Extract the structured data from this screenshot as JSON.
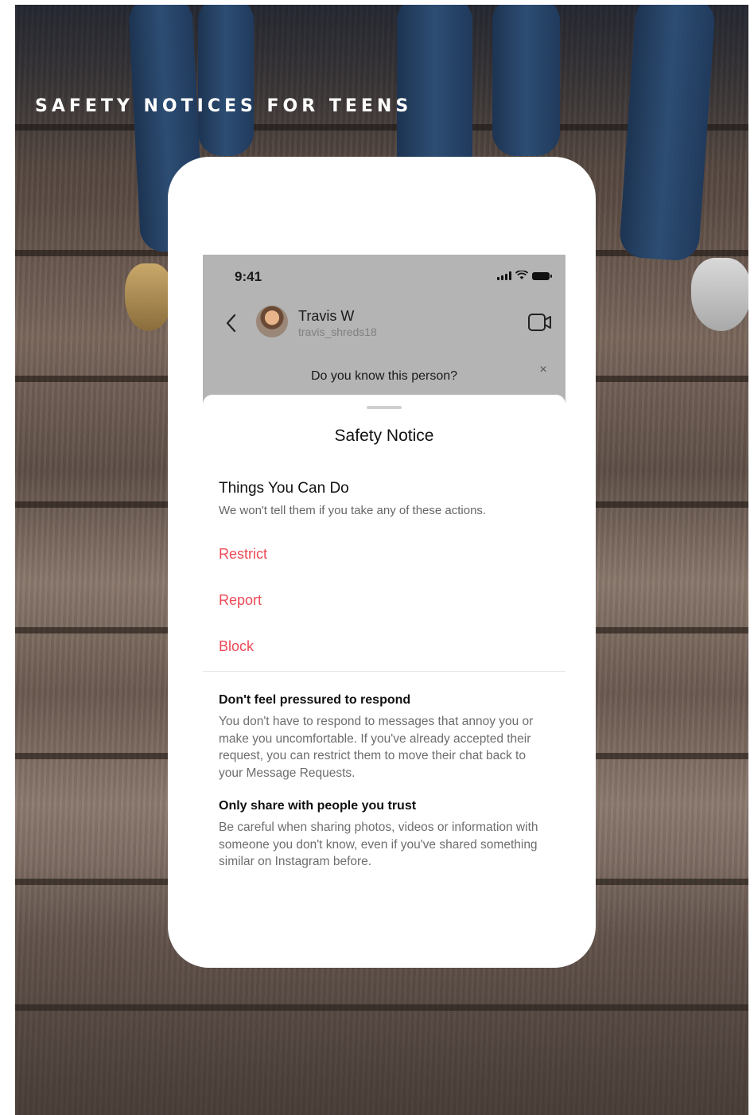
{
  "page": {
    "title": "SAFETY NOTICES FOR TEENS"
  },
  "status_bar": {
    "time": "9:41"
  },
  "chat_header": {
    "name": "Travis W",
    "handle": "travis_shreds18"
  },
  "prompt": {
    "text": "Do you know this person?",
    "close": "×"
  },
  "sheet": {
    "title": "Safety Notice",
    "things_heading": "Things You Can Do",
    "things_sub": "We won't tell them if you take any of these actions.",
    "actions": [
      {
        "label": "Restrict"
      },
      {
        "label": "Report"
      },
      {
        "label": "Block"
      }
    ],
    "tips": [
      {
        "heading": "Don't feel pressured to respond",
        "body": "You don't have to respond to messages that annoy you or make you uncomfortable. If you've already accepted their request, you can restrict them to move their chat back to your Message Requests."
      },
      {
        "heading": "Only share with people you trust",
        "body": "Be careful when sharing photos, videos or information with someone you don't know, even if you've shared something similar on Instagram before."
      }
    ]
  },
  "colors": {
    "action": "#ed4956",
    "dim_overlay": "#b4b4b4"
  },
  "icons": [
    "back-chevron-icon",
    "video-call-icon",
    "cellular-signal-icon",
    "wifi-icon",
    "battery-icon",
    "close-icon"
  ]
}
